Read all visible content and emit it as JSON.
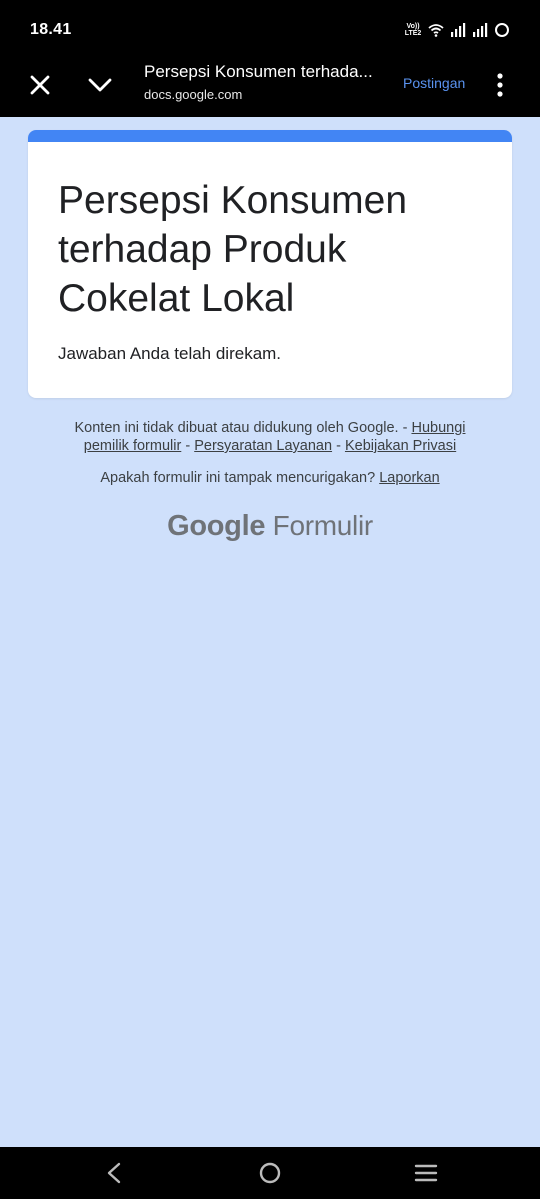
{
  "status_bar": {
    "time": "18.41",
    "volte_label": "Vo))",
    "lte_label": "LTE2",
    "icons": [
      "volte-lte-icon",
      "wifi-icon",
      "signal-sim1-icon",
      "signal-sim2-icon",
      "status-circle-icon"
    ]
  },
  "toolbar": {
    "title": "Persepsi Konsumen terhada...",
    "url": "docs.google.com",
    "action_label": "Postingan",
    "action_color": "#5a93f0"
  },
  "form": {
    "title": "Persepsi Konsumen terhadap Produk Cokelat Lokal",
    "confirmation": "Jawaban Anda telah direkam.",
    "accent_color": "#4285f4"
  },
  "footer": {
    "disclaimer_text": "Konten ini tidak dibuat atau didukung oleh Google. -",
    "contact_link": "Hubungi pemilik formulir",
    "separator1": "-",
    "terms_link": "Persyaratan Layanan",
    "separator2": "-",
    "privacy_link": "Kebijakan Privasi",
    "report_question": "Apakah formulir ini tampak mencurigakan?",
    "report_link": "Laporkan",
    "brand_google": "Google",
    "brand_product": "Formulir"
  },
  "nav_bar": {
    "icons": [
      "back-icon",
      "home-icon",
      "recents-icon"
    ]
  },
  "colors": {
    "page_background": "#cfe0fb",
    "bar_background": "#000000"
  }
}
